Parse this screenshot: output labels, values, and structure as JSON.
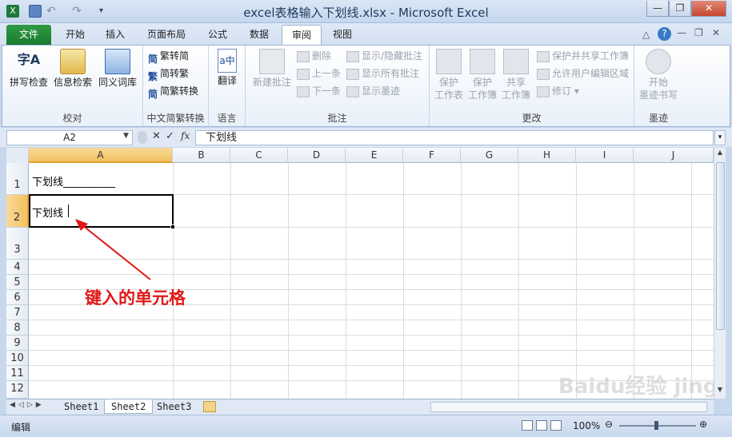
{
  "window": {
    "title": "excel表格输入下划线.xlsx - Microsoft Excel",
    "min": "—",
    "max": "❐",
    "close": "✕"
  },
  "tabs": [
    "文件",
    "开始",
    "插入",
    "页面布局",
    "公式",
    "数据",
    "审阅",
    "视图"
  ],
  "ribbon": {
    "proofing": {
      "label": "校对",
      "spell": "拼写检查",
      "research": "信息检索",
      "thesaurus": "同义词库"
    },
    "chinese": {
      "label": "中文简繁转换",
      "t2s": "繁转简",
      "s2t": "简转繁",
      "convert": "简繁转换"
    },
    "language": {
      "label": "语言",
      "translate": "翻译"
    },
    "comments": {
      "label": "批注",
      "new": "新建批注",
      "delete": "删除",
      "prev": "上一条",
      "next": "下一条",
      "showhide": "显示/隐藏批注",
      "showall": "显示所有批注",
      "showink": "显示墨迹"
    },
    "changes": {
      "label": "更改",
      "protect_sheet_1": "保护",
      "protect_sheet_2": "工作表",
      "protect_wb_1": "保护",
      "protect_wb_2": "工作簿",
      "share_1": "共享",
      "share_2": "工作簿",
      "protect_share": "保护并共享工作簿",
      "allow_edit": "允许用户编辑区域",
      "track": "修订"
    },
    "ink": {
      "label": "墨迹",
      "start_1": "开始",
      "start_2": "墨迹书写"
    }
  },
  "formula": {
    "namebox": "A2",
    "content": "下划线"
  },
  "columns": [
    "A",
    "B",
    "C",
    "D",
    "E",
    "F",
    "G",
    "H",
    "I",
    "J"
  ],
  "rows": [
    "1",
    "2",
    "3",
    "4",
    "5",
    "6",
    "7",
    "8",
    "9",
    "10",
    "11",
    "12"
  ],
  "cells": {
    "A1": "下划线__________",
    "A2": "下划线"
  },
  "annotation": "键入的单元格",
  "sheets": [
    "Sheet1",
    "Sheet2",
    "Sheet3"
  ],
  "active_sheet": "Sheet2",
  "status": {
    "mode": "编辑",
    "zoom": "100%"
  },
  "watermark": "Baidu经验 jingyan.baidu.com",
  "colors": {
    "file_tab": "#2f9b43",
    "annotation": "#e01818"
  }
}
